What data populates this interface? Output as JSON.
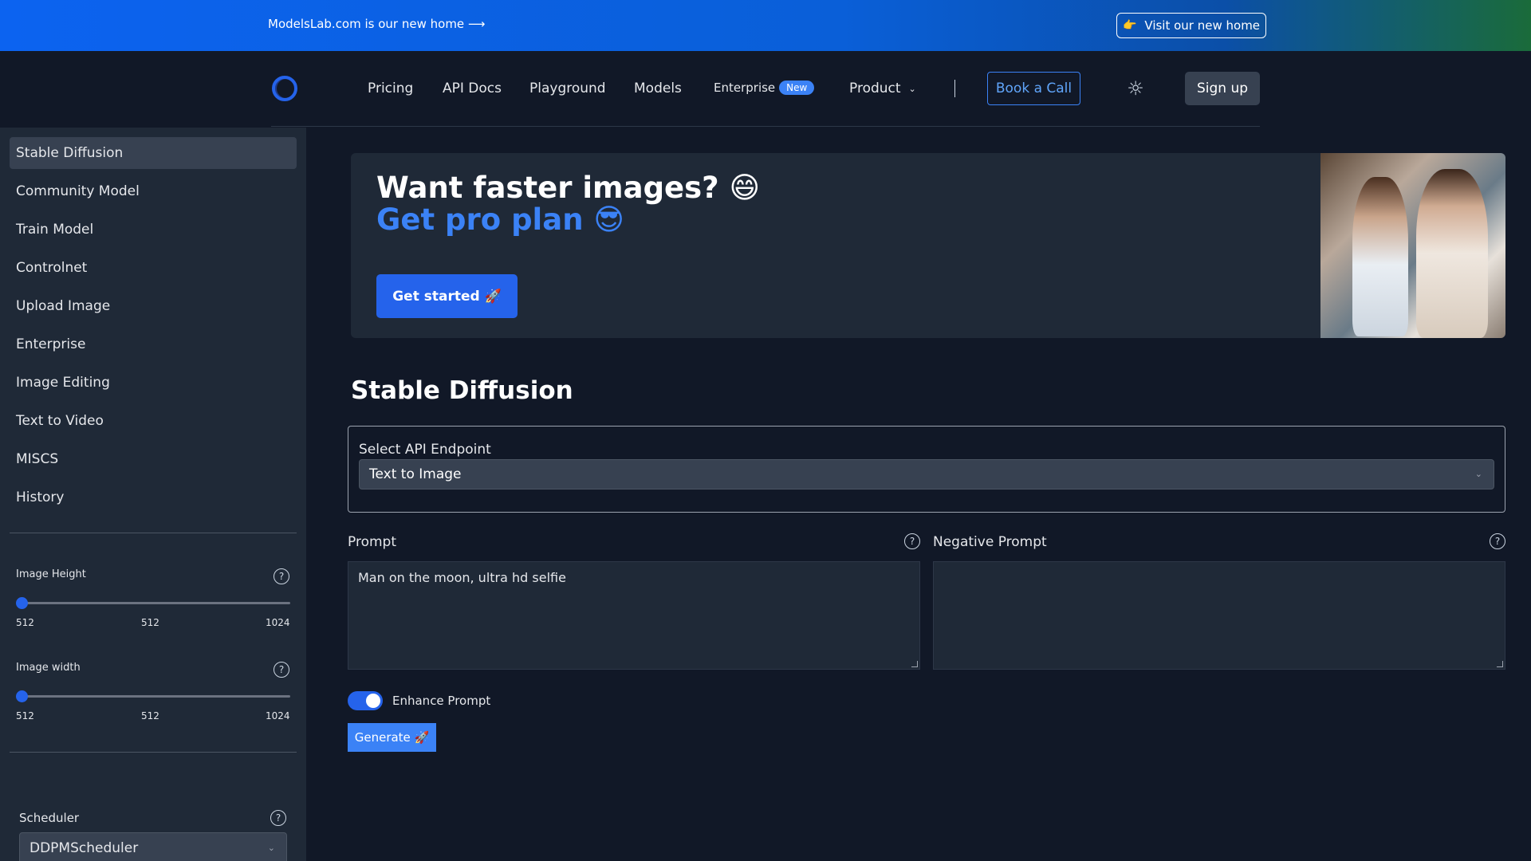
{
  "announcement": {
    "text": "ModelsLab.com is our new home ⟶",
    "button_label": "Visit our new home",
    "button_icon": "pointing-hand-icon"
  },
  "nav": {
    "items": [
      "Pricing",
      "API Docs",
      "Playground",
      "Models"
    ],
    "enterprise_label": "Enterprise",
    "enterprise_badge": "New",
    "product_label": "Product",
    "book_call_label": "Book a Call",
    "theme_icon": "sun-icon",
    "signup_label": "Sign up"
  },
  "sidebar": {
    "items": [
      {
        "label": "Stable Diffusion",
        "active": true
      },
      {
        "label": "Community Model"
      },
      {
        "label": "Train Model"
      },
      {
        "label": "Controlnet"
      },
      {
        "label": "Upload Image"
      },
      {
        "label": "Enterprise"
      },
      {
        "label": "Image Editing"
      },
      {
        "label": "Text to Video"
      },
      {
        "label": "MISCS"
      },
      {
        "label": "History"
      }
    ],
    "sliders": [
      {
        "label": "Image Height",
        "min": "512",
        "value": "512",
        "max": "1024"
      },
      {
        "label": "Image width",
        "min": "512",
        "value": "512",
        "max": "1024"
      }
    ],
    "scheduler": {
      "label": "Scheduler",
      "value": "DDPMScheduler"
    }
  },
  "promo": {
    "headline": "Want faster images? 😄",
    "subheadline": "Get pro plan 😎",
    "button_label": "Get started 🚀"
  },
  "main": {
    "title": "Stable Diffusion",
    "endpoint_label": "Select API Endpoint",
    "endpoint_value": "Text to Image",
    "prompt_label": "Prompt",
    "prompt_value": "Man on the moon, ultra hd selfie",
    "negative_label": "Negative Prompt",
    "negative_value": "",
    "enhance_label": "Enhance Prompt",
    "enhance_on": true,
    "generate_label": "Generate 🚀"
  },
  "colors": {
    "accent": "#2563eb",
    "background": "#111827",
    "panel": "#1f2937"
  }
}
